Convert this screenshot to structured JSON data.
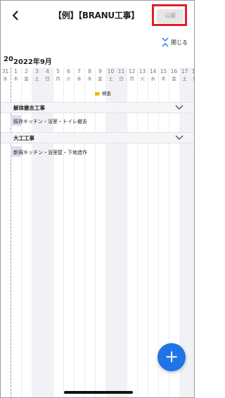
{
  "header": {
    "title": "【例】【BRANU工事】",
    "publish_label": "公開",
    "close_label": "閉じる"
  },
  "calendar": {
    "prev_month_fragment": "20",
    "month_label": "2022年9月",
    "days": [
      {
        "d": "31",
        "w": "水",
        "weekend": false
      },
      {
        "d": "1",
        "w": "木",
        "weekend": false
      },
      {
        "d": "2",
        "w": "金",
        "weekend": false
      },
      {
        "d": "3",
        "w": "土",
        "weekend": true
      },
      {
        "d": "4",
        "w": "日",
        "weekend": true
      },
      {
        "d": "5",
        "w": "月",
        "weekend": false
      },
      {
        "d": "6",
        "w": "火",
        "weekend": false
      },
      {
        "d": "7",
        "w": "水",
        "weekend": false
      },
      {
        "d": "8",
        "w": "木",
        "weekend": false
      },
      {
        "d": "9",
        "w": "金",
        "weekend": false
      },
      {
        "d": "10",
        "w": "土",
        "weekend": true
      },
      {
        "d": "11",
        "w": "日",
        "weekend": true
      },
      {
        "d": "12",
        "w": "月",
        "weekend": false
      },
      {
        "d": "13",
        "w": "火",
        "weekend": false
      },
      {
        "d": "14",
        "w": "水",
        "weekend": false
      },
      {
        "d": "15",
        "w": "木",
        "weekend": false
      },
      {
        "d": "16",
        "w": "金",
        "weekend": false
      },
      {
        "d": "17",
        "w": "土",
        "weekend": true
      },
      {
        "d": "18",
        "w": "日",
        "weekend": true
      }
    ]
  },
  "milestone": {
    "label": "検査",
    "color": "#f5b700"
  },
  "sections": [
    {
      "title": "解体撤去工事",
      "tasks": [
        {
          "label": "既存キッチン・浴室・トイレ撤去"
        }
      ]
    },
    {
      "title": "大工工事",
      "tasks": [
        {
          "label": "新規キッチン・浴室壁・下地造作"
        }
      ]
    }
  ],
  "fab": {
    "label": "+",
    "color": "#1f74e8"
  },
  "icons": {
    "back": "chevron-left-icon",
    "close": "collapse-icon",
    "section_toggle": "chevron-down-icon"
  }
}
